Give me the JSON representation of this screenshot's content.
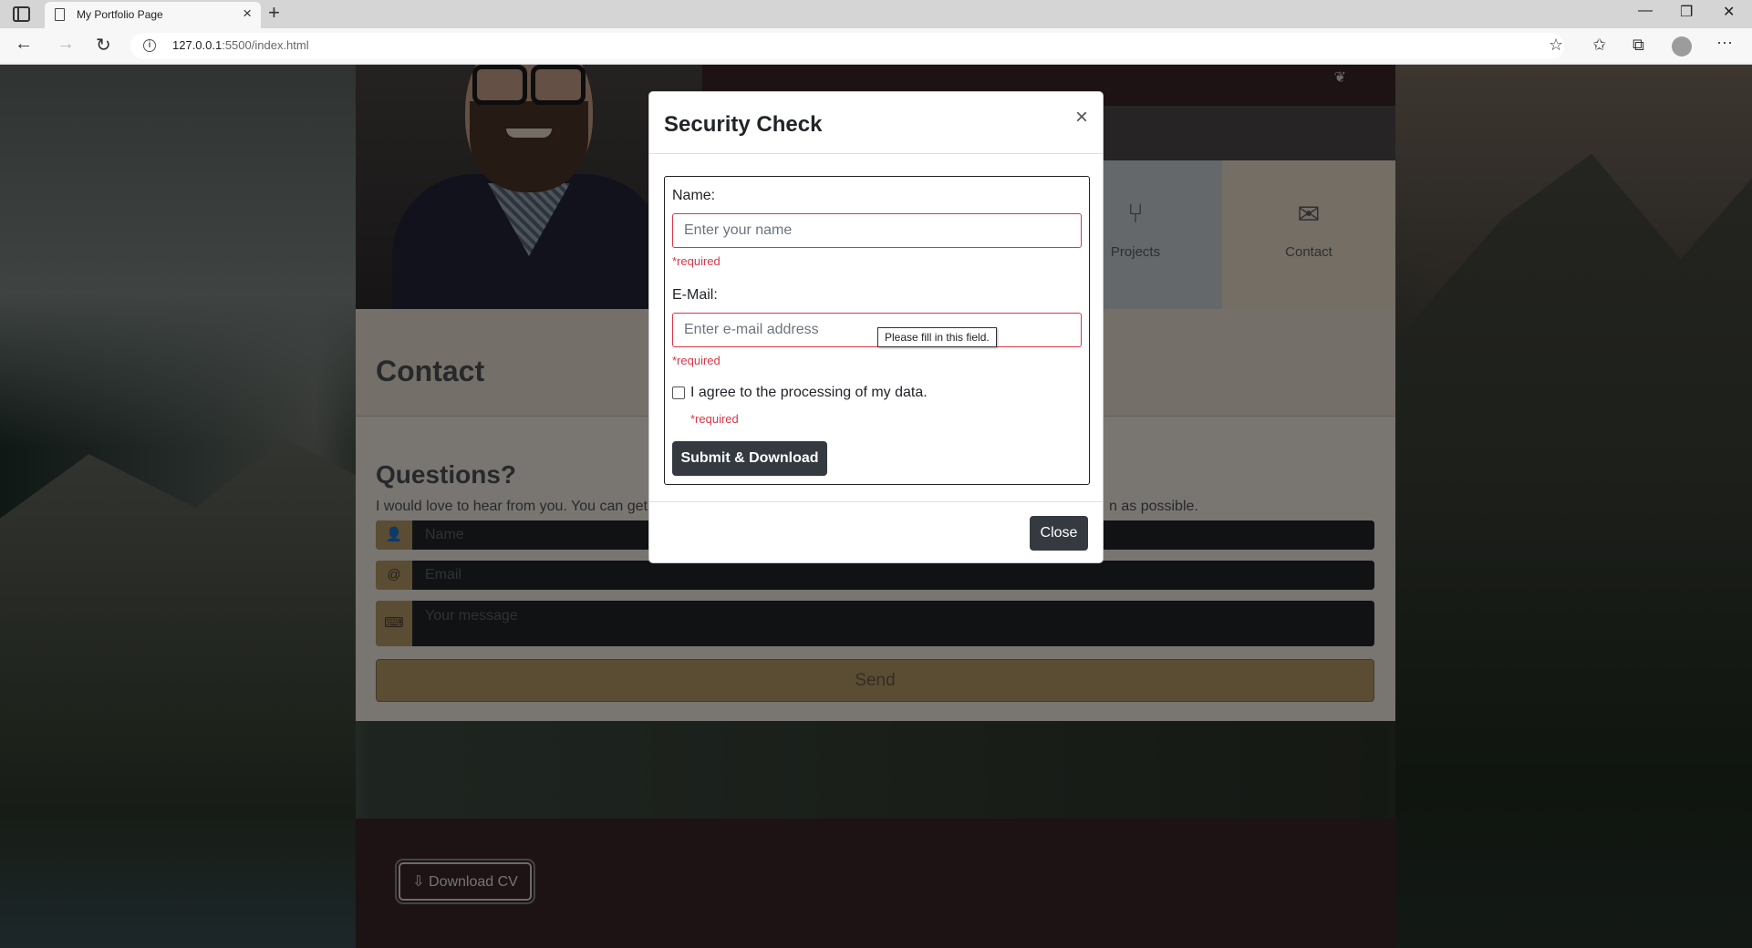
{
  "browser": {
    "tab_title": "My Portfolio Page",
    "tab_close": "×",
    "new_tab": "+",
    "url_host": "127.0.0.1",
    "url_rest": ":5500/index.html",
    "window_controls": {
      "minimize": "—",
      "restore": "❐",
      "close": "✕"
    },
    "nav": {
      "back": "←",
      "forward": "→",
      "refresh": "↻"
    },
    "toolbar_icons": [
      "favorite-add-icon",
      "favorites-icon",
      "collections-icon",
      "profile-icon",
      "more-icon"
    ],
    "more_label": "···"
  },
  "page": {
    "nav_items": [
      {
        "label": "Projects",
        "icon": "branch-icon"
      },
      {
        "label": "Contact",
        "icon": "envelope-icon"
      }
    ],
    "contact_title": "Contact",
    "questions_title": "Questions?",
    "questions_text_left": "I would love to hear from you. You can get",
    "questions_text_right": "n as possible.",
    "form": {
      "name_placeholder": "Name",
      "email_placeholder": "Email",
      "message_placeholder": "Your message",
      "email_addon": "@",
      "send_label": "Send"
    },
    "download_cv_label": "Download CV"
  },
  "modal": {
    "title": "Security Check",
    "close_x": "×",
    "name_label": "Name:",
    "name_placeholder": "Enter your name",
    "name_required": "*required",
    "email_label": "E-Mail:",
    "email_placeholder": "Enter e-mail address",
    "email_required": "*required",
    "consent_label": "I agree to the processing of my data.",
    "consent_required": "*required",
    "submit_label": "Submit & Download",
    "tooltip": "Please fill in this field.",
    "close_label": "Close"
  },
  "colors": {
    "brand_dark": "#3a2528",
    "accent_gold": "#b79a68",
    "danger": "#dc3545",
    "button_dark": "#343a40"
  }
}
